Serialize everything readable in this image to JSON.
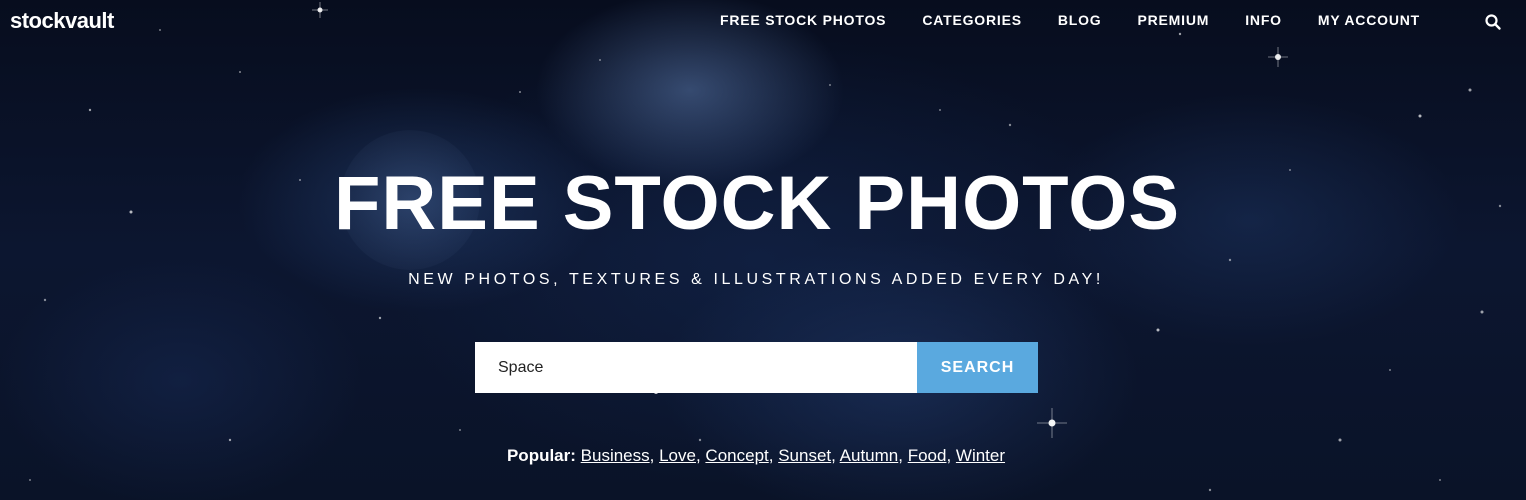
{
  "header": {
    "logo": "stockvault",
    "nav": [
      "FREE STOCK PHOTOS",
      "CATEGORIES",
      "BLOG",
      "PREMIUM",
      "INFO",
      "MY ACCOUNT"
    ],
    "search_icon": "search-icon"
  },
  "hero": {
    "title": "FREE STOCK PHOTOS",
    "subtitle": "NEW PHOTOS, TEXTURES & ILLUSTRATIONS ADDED EVERY DAY!"
  },
  "search": {
    "value": "Space",
    "button_label": "SEARCH"
  },
  "popular": {
    "label": "Popular:",
    "tags": [
      "Business",
      "Love",
      "Concept",
      "Sunset",
      "Autumn",
      "Food",
      "Winter"
    ]
  },
  "colors": {
    "accent": "#5aa9df",
    "background": "#0a1226",
    "text": "#ffffff"
  }
}
